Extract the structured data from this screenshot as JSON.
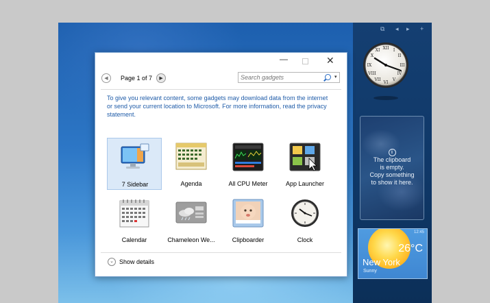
{
  "window": {
    "minimize_glyph": "—",
    "close_glyph": "✕"
  },
  "pager": {
    "prev_glyph": "◀",
    "text": "Page 1 of 7",
    "next_glyph": "▶"
  },
  "search": {
    "placeholder": "Search gadgets",
    "dropdown_glyph": "▾"
  },
  "info_text": "To give you relevant content, some gadgets may download data from the internet or send your current location to Microsoft. For more information, read the privacy statement.",
  "gadgets": [
    {
      "label": "7 Sidebar",
      "icon": "sidebar-icon",
      "selected": true
    },
    {
      "label": "Agenda",
      "icon": "agenda-icon",
      "selected": false
    },
    {
      "label": "All CPU Meter",
      "icon": "cpu-meter-icon",
      "selected": false
    },
    {
      "label": "App Launcher",
      "icon": "app-launcher-icon",
      "selected": false
    },
    {
      "label": "Calendar",
      "icon": "calendar-icon",
      "selected": false
    },
    {
      "label": "Chameleon We...",
      "icon": "weather-icon",
      "selected": false
    },
    {
      "label": "Clipboarder",
      "icon": "clipboarder-icon",
      "selected": false
    },
    {
      "label": "Clock",
      "icon": "clock-icon",
      "selected": false
    }
  ],
  "details": {
    "glyph": "⌄",
    "label": "Show details"
  },
  "sidebar": {
    "toolbar": [
      "⧉",
      "◂",
      "▸",
      "+"
    ],
    "clipboard": {
      "icon_glyph": "i",
      "lines": [
        "The clipboard",
        "is empty.",
        "Copy something",
        "to show it here."
      ]
    },
    "weather": {
      "time": "12:45",
      "temperature": "26°C",
      "city": "New York",
      "condition": "Sunny"
    }
  },
  "colors": {
    "link": "#1e5ba8",
    "selection": "#dbe9f8",
    "sidebar": "#143f72"
  }
}
